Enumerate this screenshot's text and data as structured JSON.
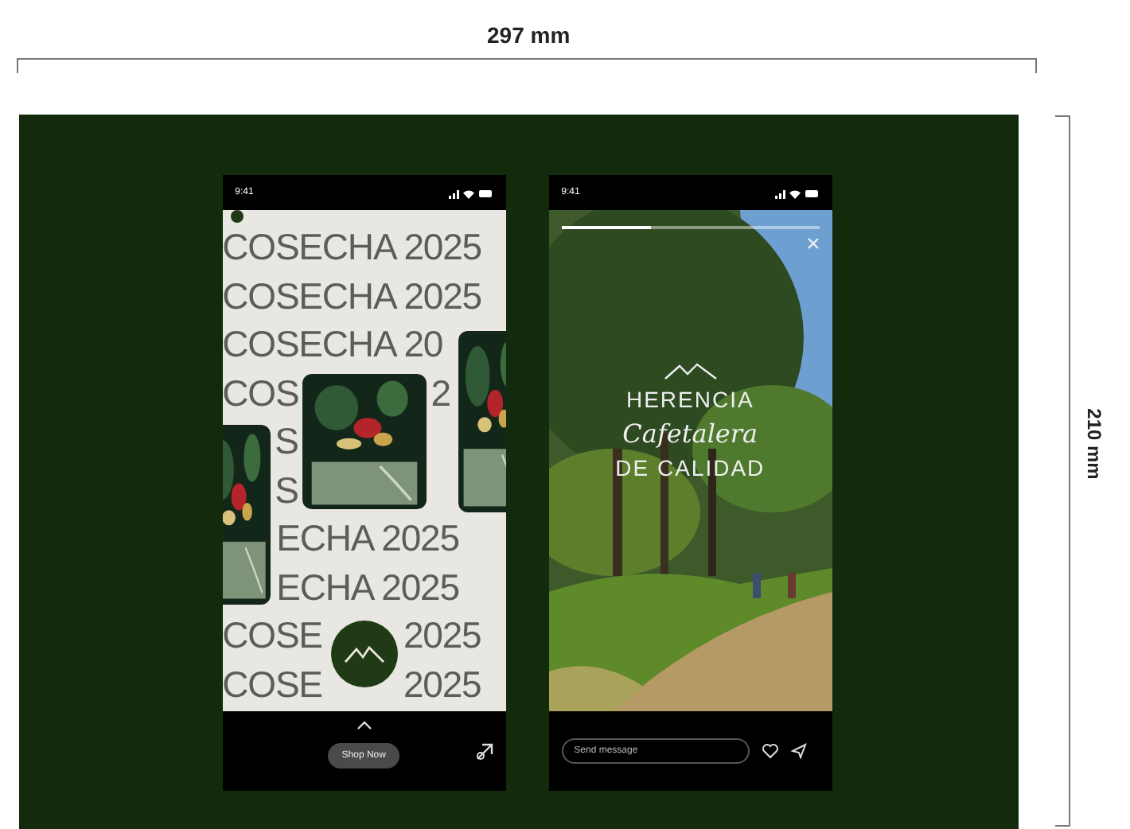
{
  "dimensions": {
    "width_label": "297 mm",
    "height_label": "210 mm"
  },
  "phones": [
    {
      "kind": "feed",
      "status_time": "9:41",
      "lines": [
        [
          "COSECHA 2025"
        ],
        [
          "COSECHA 2025"
        ],
        [
          "COSECHA 20"
        ],
        [
          "COS",
          "2"
        ],
        [
          "S"
        ],
        [
          "S"
        ],
        [
          "ECHA 2025"
        ],
        [
          "ECHA 2025"
        ],
        [
          "COSE",
          "2025"
        ],
        [
          "COSE",
          "2025"
        ]
      ],
      "button": "Shop Now"
    },
    {
      "kind": "story",
      "status_time": "9:41",
      "progress": {
        "level": 0.35
      },
      "headline": "HERENCIA",
      "script": "Cafetalera",
      "tagline": "DE CALIDAD",
      "message_placeholder": "Send message"
    }
  ]
}
